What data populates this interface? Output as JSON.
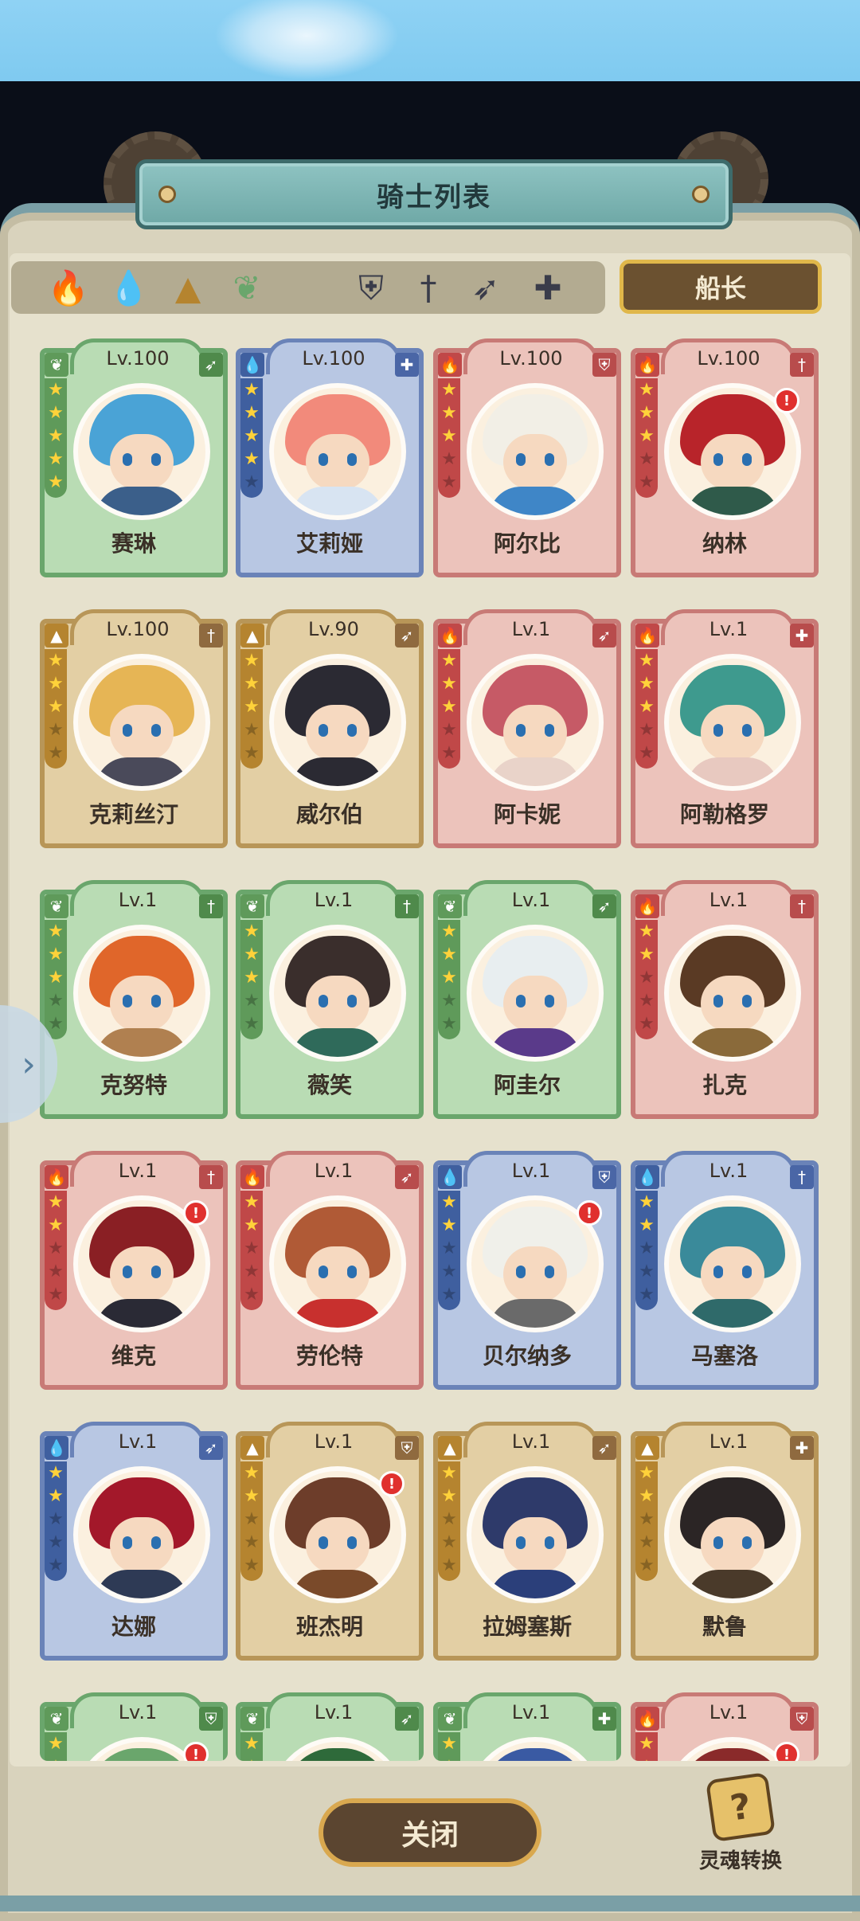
{
  "title": "骑士列表",
  "filters": {
    "elements": [
      "fire-element-icon",
      "water-element-icon",
      "earth-element-icon",
      "wind-element-icon"
    ],
    "classes": [
      "shield-class-icon",
      "sword-class-icon",
      "bow-class-icon",
      "healer-class-icon"
    ]
  },
  "captain_label": "船长",
  "close_label": "关闭",
  "soul_convert_label": "灵魂转换",
  "soul_icon_glyph": "?",
  "side_tab_glyph": "›",
  "alert_glyph": "!",
  "element_glyphs": {
    "fire": "🔥",
    "water": "💧",
    "earth": "▲",
    "wind": "❦"
  },
  "class_glyphs": {
    "shield": "⛨",
    "sword": "†",
    "bow": "➶",
    "healer": "✚"
  },
  "knights": [
    {
      "name": "赛琳",
      "level": "Lv.100",
      "element": "wind",
      "class": "bow",
      "stars": 5,
      "alert": false
    },
    {
      "name": "艾莉娅",
      "level": "Lv.100",
      "element": "water",
      "class": "healer",
      "stars": 4,
      "alert": false
    },
    {
      "name": "阿尔比",
      "level": "Lv.100",
      "element": "fire",
      "class": "shield",
      "stars": 3,
      "alert": false
    },
    {
      "name": "纳林",
      "level": "Lv.100",
      "element": "fire",
      "class": "sword",
      "stars": 3,
      "alert": true
    },
    {
      "name": "克莉丝汀",
      "level": "Lv.100",
      "element": "earth",
      "class": "sword",
      "stars": 3,
      "alert": false
    },
    {
      "name": "威尔伯",
      "level": "Lv.90",
      "element": "earth",
      "class": "bow",
      "stars": 3,
      "alert": false
    },
    {
      "name": "阿卡妮",
      "level": "Lv.1",
      "element": "fire",
      "class": "bow",
      "stars": 3,
      "alert": false
    },
    {
      "name": "阿勒格罗",
      "level": "Lv.1",
      "element": "fire",
      "class": "healer",
      "stars": 3,
      "alert": false
    },
    {
      "name": "克努特",
      "level": "Lv.1",
      "element": "wind",
      "class": "sword",
      "stars": 3,
      "alert": false
    },
    {
      "name": "薇笑",
      "level": "Lv.1",
      "element": "wind",
      "class": "sword",
      "stars": 3,
      "alert": false
    },
    {
      "name": "阿圭尔",
      "level": "Lv.1",
      "element": "wind",
      "class": "bow",
      "stars": 3,
      "alert": false
    },
    {
      "name": "扎克",
      "level": "Lv.1",
      "element": "fire",
      "class": "sword",
      "stars": 2,
      "alert": false
    },
    {
      "name": "维克",
      "level": "Lv.1",
      "element": "fire",
      "class": "sword",
      "stars": 2,
      "alert": true
    },
    {
      "name": "劳伦特",
      "level": "Lv.1",
      "element": "fire",
      "class": "bow",
      "stars": 2,
      "alert": false
    },
    {
      "name": "贝尔纳多",
      "level": "Lv.1",
      "element": "water",
      "class": "shield",
      "stars": 2,
      "alert": true
    },
    {
      "name": "马塞洛",
      "level": "Lv.1",
      "element": "water",
      "class": "sword",
      "stars": 2,
      "alert": false
    },
    {
      "name": "达娜",
      "level": "Lv.1",
      "element": "water",
      "class": "bow",
      "stars": 2,
      "alert": false
    },
    {
      "name": "班杰明",
      "level": "Lv.1",
      "element": "earth",
      "class": "shield",
      "stars": 2,
      "alert": true
    },
    {
      "name": "拉姆塞斯",
      "level": "Lv.1",
      "element": "earth",
      "class": "bow",
      "stars": 2,
      "alert": false
    },
    {
      "name": "默鲁",
      "level": "Lv.1",
      "element": "earth",
      "class": "healer",
      "stars": 2,
      "alert": false
    },
    {
      "name": "",
      "level": "Lv.1",
      "element": "wind",
      "class": "shield",
      "stars": 2,
      "alert": true
    },
    {
      "name": "",
      "level": "Lv.1",
      "element": "wind",
      "class": "bow",
      "stars": 2,
      "alert": false
    },
    {
      "name": "",
      "level": "Lv.1",
      "element": "wind",
      "class": "healer",
      "stars": 2,
      "alert": false
    },
    {
      "name": "",
      "level": "Lv.1",
      "element": "fire",
      "class": "shield",
      "stars": 2,
      "alert": true
    }
  ],
  "colors": {
    "wind": "#5f9a5a",
    "water": "#3f5f9f",
    "fire": "#c04848",
    "earth": "#b5842f",
    "accent_gold": "#e0b74a",
    "title_teal": "#6ea8a6"
  }
}
